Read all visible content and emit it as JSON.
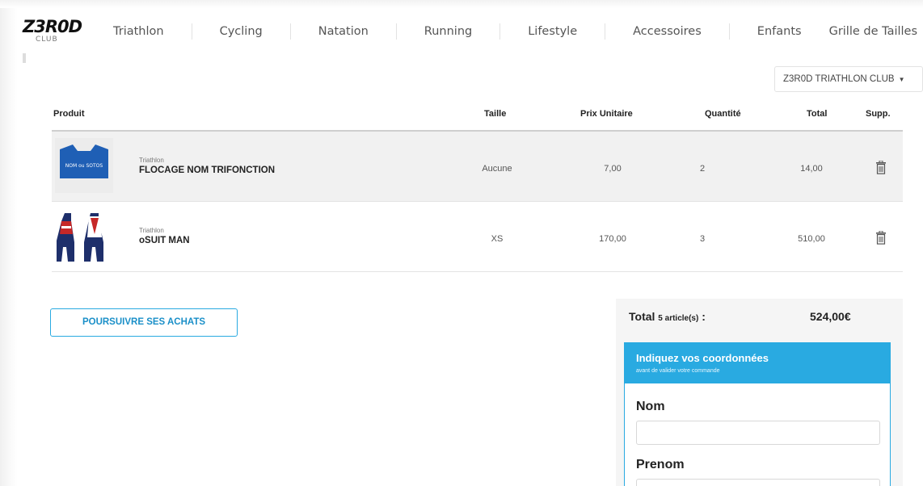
{
  "header": {
    "logo_main": "Z3R0D",
    "logo_sub": "CLUB",
    "nav": [
      "Triathlon",
      "Cycling",
      "Natation",
      "Running",
      "Lifestyle",
      "Accessoires",
      "Enfants",
      "Grille de Tailles"
    ],
    "club_selector": "Z3R0D TRIATHLON CLUB"
  },
  "cart": {
    "columns": {
      "product": "Produit",
      "size": "Taille",
      "unit_price": "Prix Unitaire",
      "quantity": "Quantité",
      "total": "Total",
      "delete": "Supp."
    },
    "items": [
      {
        "category": "Triathlon",
        "name": "FLOCAGE NOM TRIFONCTION",
        "thumb_text": "NOM ou SOTOS",
        "size": "Aucune",
        "unit_price": "7,00",
        "quantity": "2",
        "total": "14,00"
      },
      {
        "category": "Triathlon",
        "name": "oSUIT MAN",
        "size": "XS",
        "unit_price": "170,00",
        "quantity": "3",
        "total": "510,00"
      }
    ]
  },
  "actions": {
    "continue_shopping": "POURSUIVRE SES ACHATS"
  },
  "summary": {
    "total_label": "Total",
    "count_text": "5 article(s)",
    "colon": ":",
    "total_value": "524,00€"
  },
  "contact_form": {
    "title": "Indiquez vos coordonnées",
    "subtitle": "avant de valider votre commande",
    "fields": [
      {
        "label": "Nom",
        "value": ""
      },
      {
        "label": "Prenom",
        "value": ""
      }
    ]
  },
  "colors": {
    "accent": "#29aae1",
    "shaded_row": "#f1f1f1",
    "navy": "#1e2f6b",
    "red": "#c62828"
  }
}
